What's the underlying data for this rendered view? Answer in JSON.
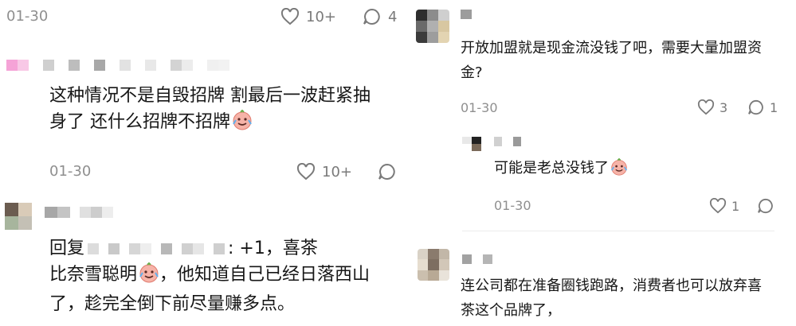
{
  "left": {
    "top_meta": {
      "date": "01-30",
      "likes": "10+",
      "replies": "4"
    },
    "comment1": {
      "text_line1": "这种情况不是自毁招牌 割最后一波赶紧抽",
      "text_line2": "身了 还什么招牌不招牌",
      "date": "01-30",
      "likes": "10+"
    },
    "comment2": {
      "reply_prefix": "回复",
      "reply_suffix": ": +1，喜茶",
      "line2": "比奈雪聪明",
      "line2_tail": "，他知道自己已经日落西山",
      "line3": "了，趁完全倒下前尽量赚多点。"
    }
  },
  "right": {
    "comment1": {
      "line1": "开放加盟就是现金流没钱了吧，需要大量加盟资",
      "line2": "金?",
      "date": "01-30",
      "likes": "3",
      "replies": "1"
    },
    "reply1": {
      "text": "可能是老总没钱了",
      "date": "01-30",
      "likes": "1"
    },
    "comment2": {
      "line1": "连公司都在准备圈钱跑路，消费者也可以放弃喜",
      "line2": "茶这个品牌了，"
    }
  },
  "colors": {
    "text": "#161616",
    "meta": "#8f8f8f",
    "icon": "#7a7a7a",
    "divider": "#ececec",
    "emoji_face": "#f6b3a8"
  },
  "icons": [
    "heart-icon",
    "comment-bubble-icon",
    "crying-laugh-emoji-icon"
  ]
}
